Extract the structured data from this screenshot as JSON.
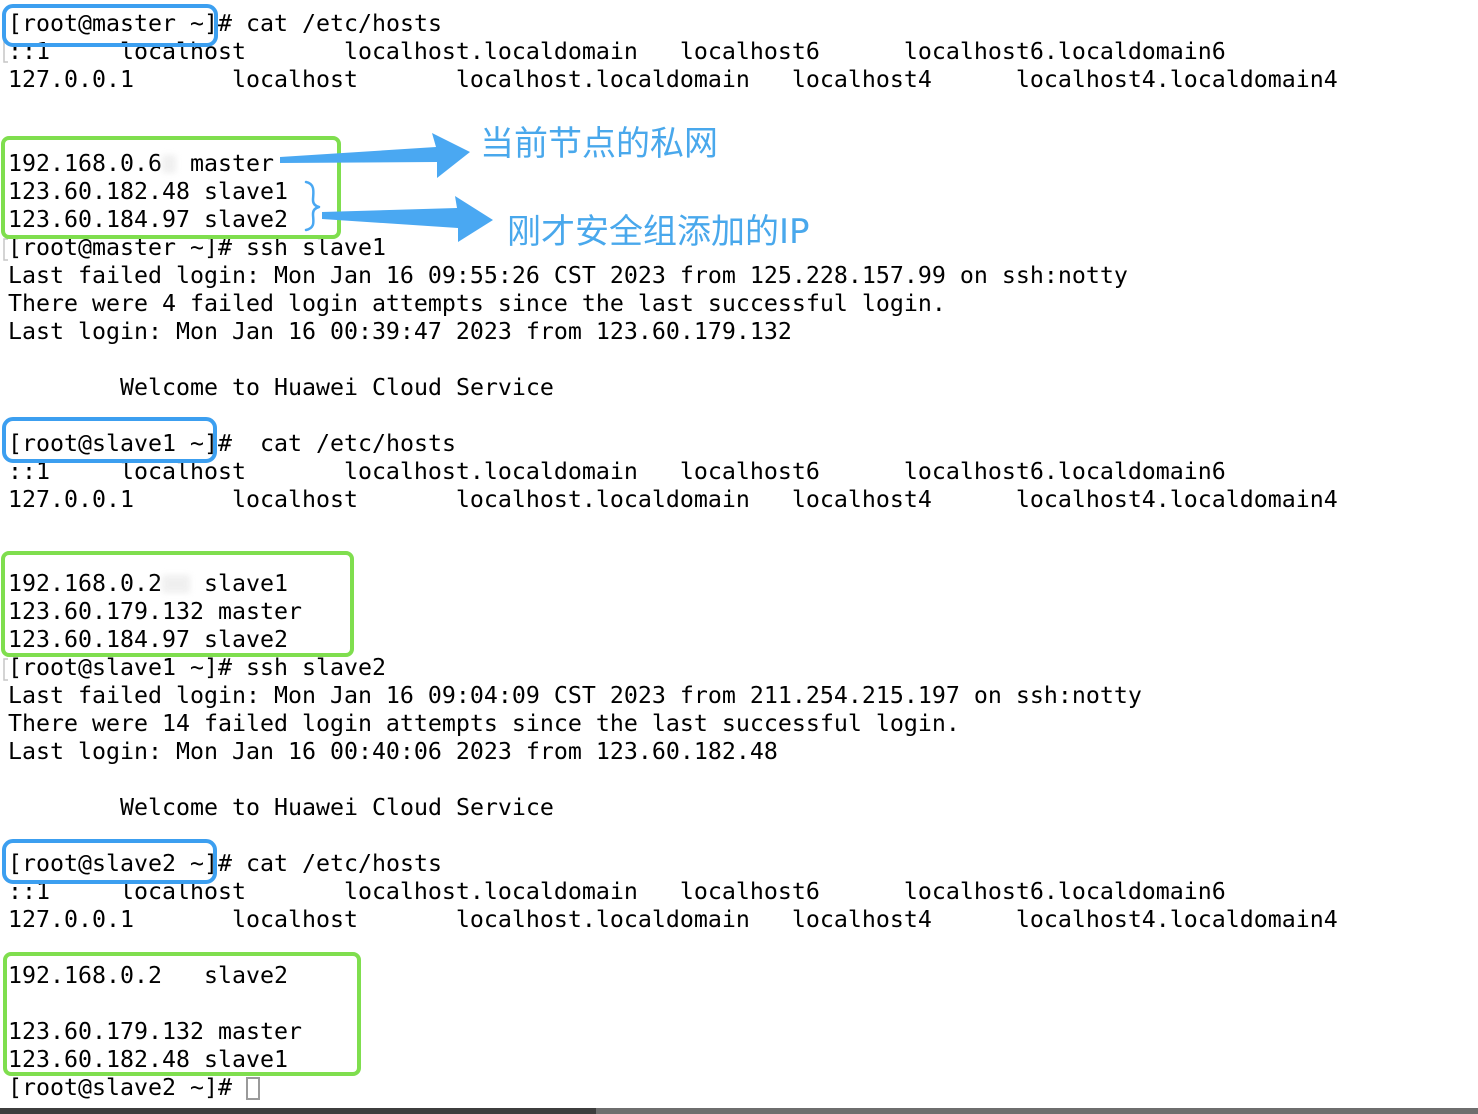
{
  "colors": {
    "terminal_background": "#ffffff",
    "terminal_text": "#000000",
    "prompt_highlight": "#3c9ff0",
    "hosts_highlight": "#7fde4e",
    "arrow_fill": "#4aa8f2",
    "annotation_text": "#49a8ec",
    "cursor": "#9a9a9a"
  },
  "terminal": {
    "lines": [
      {
        "prompt": "[root@master ~]#",
        "command": "cat /etc/hosts"
      },
      "::1     localhost       localhost.localdomain   localhost6      localhost6.localdomain6",
      "127.0.0.1       localhost       localhost.localdomain   localhost4      localhost4.localdomain4",
      {
        "ip_visible": "192.168.0.6",
        "hostname": "master"
      },
      "123.60.182.48 slave1",
      "123.60.184.97 slave2",
      {
        "prompt": "[root@master ~]#",
        "command": "ssh slave1"
      },
      "Last failed login: Mon Jan 16 09:55:26 CST 2023 from 125.228.157.99 on ssh:notty",
      "There were 4 failed login attempts since the last successful login.",
      "Last login: Mon Jan 16 00:39:47 2023 from 123.60.179.132",
      "Welcome to Huawei Cloud Service",
      {
        "prompt": "[root@slave1 ~]#",
        "command": "cat /etc/hosts"
      },
      "::1     localhost       localhost.localdomain   localhost6      localhost6.localdomain6",
      "127.0.0.1       localhost       localhost.localdomain   localhost4      localhost4.localdomain4",
      {
        "ip_visible": "192.168.0.2",
        "hostname": "slave1"
      },
      "123.60.179.132 master",
      "123.60.184.97 slave2",
      {
        "prompt": "[root@slave1 ~]#",
        "command": "ssh slave2"
      },
      "Last failed login: Mon Jan 16 09:04:09 CST 2023 from 211.254.215.197 on ssh:notty",
      "There were 14 failed login attempts since the last successful login.",
      "Last login: Mon Jan 16 00:40:06 2023 from 123.60.182.48",
      "Welcome to Huawei Cloud Service",
      {
        "prompt": "[root@slave2 ~]#",
        "command": "cat /etc/hosts"
      },
      "::1     localhost       localhost.localdomain   localhost6      localhost6.localdomain6",
      "127.0.0.1       localhost       localhost.localdomain   localhost4      localhost4.localdomain4",
      "192.168.0.2   slave2",
      "123.60.179.132 master",
      "123.60.182.48 slave1",
      {
        "prompt": "[root@slave2 ~]#"
      }
    ]
  },
  "annotations": {
    "label_private_network": "当前节点的私网",
    "label_security_group_ip": "刚才安全组添加的IP",
    "icons": [
      "arrow-right-icon",
      "curly-brace-icon"
    ]
  }
}
